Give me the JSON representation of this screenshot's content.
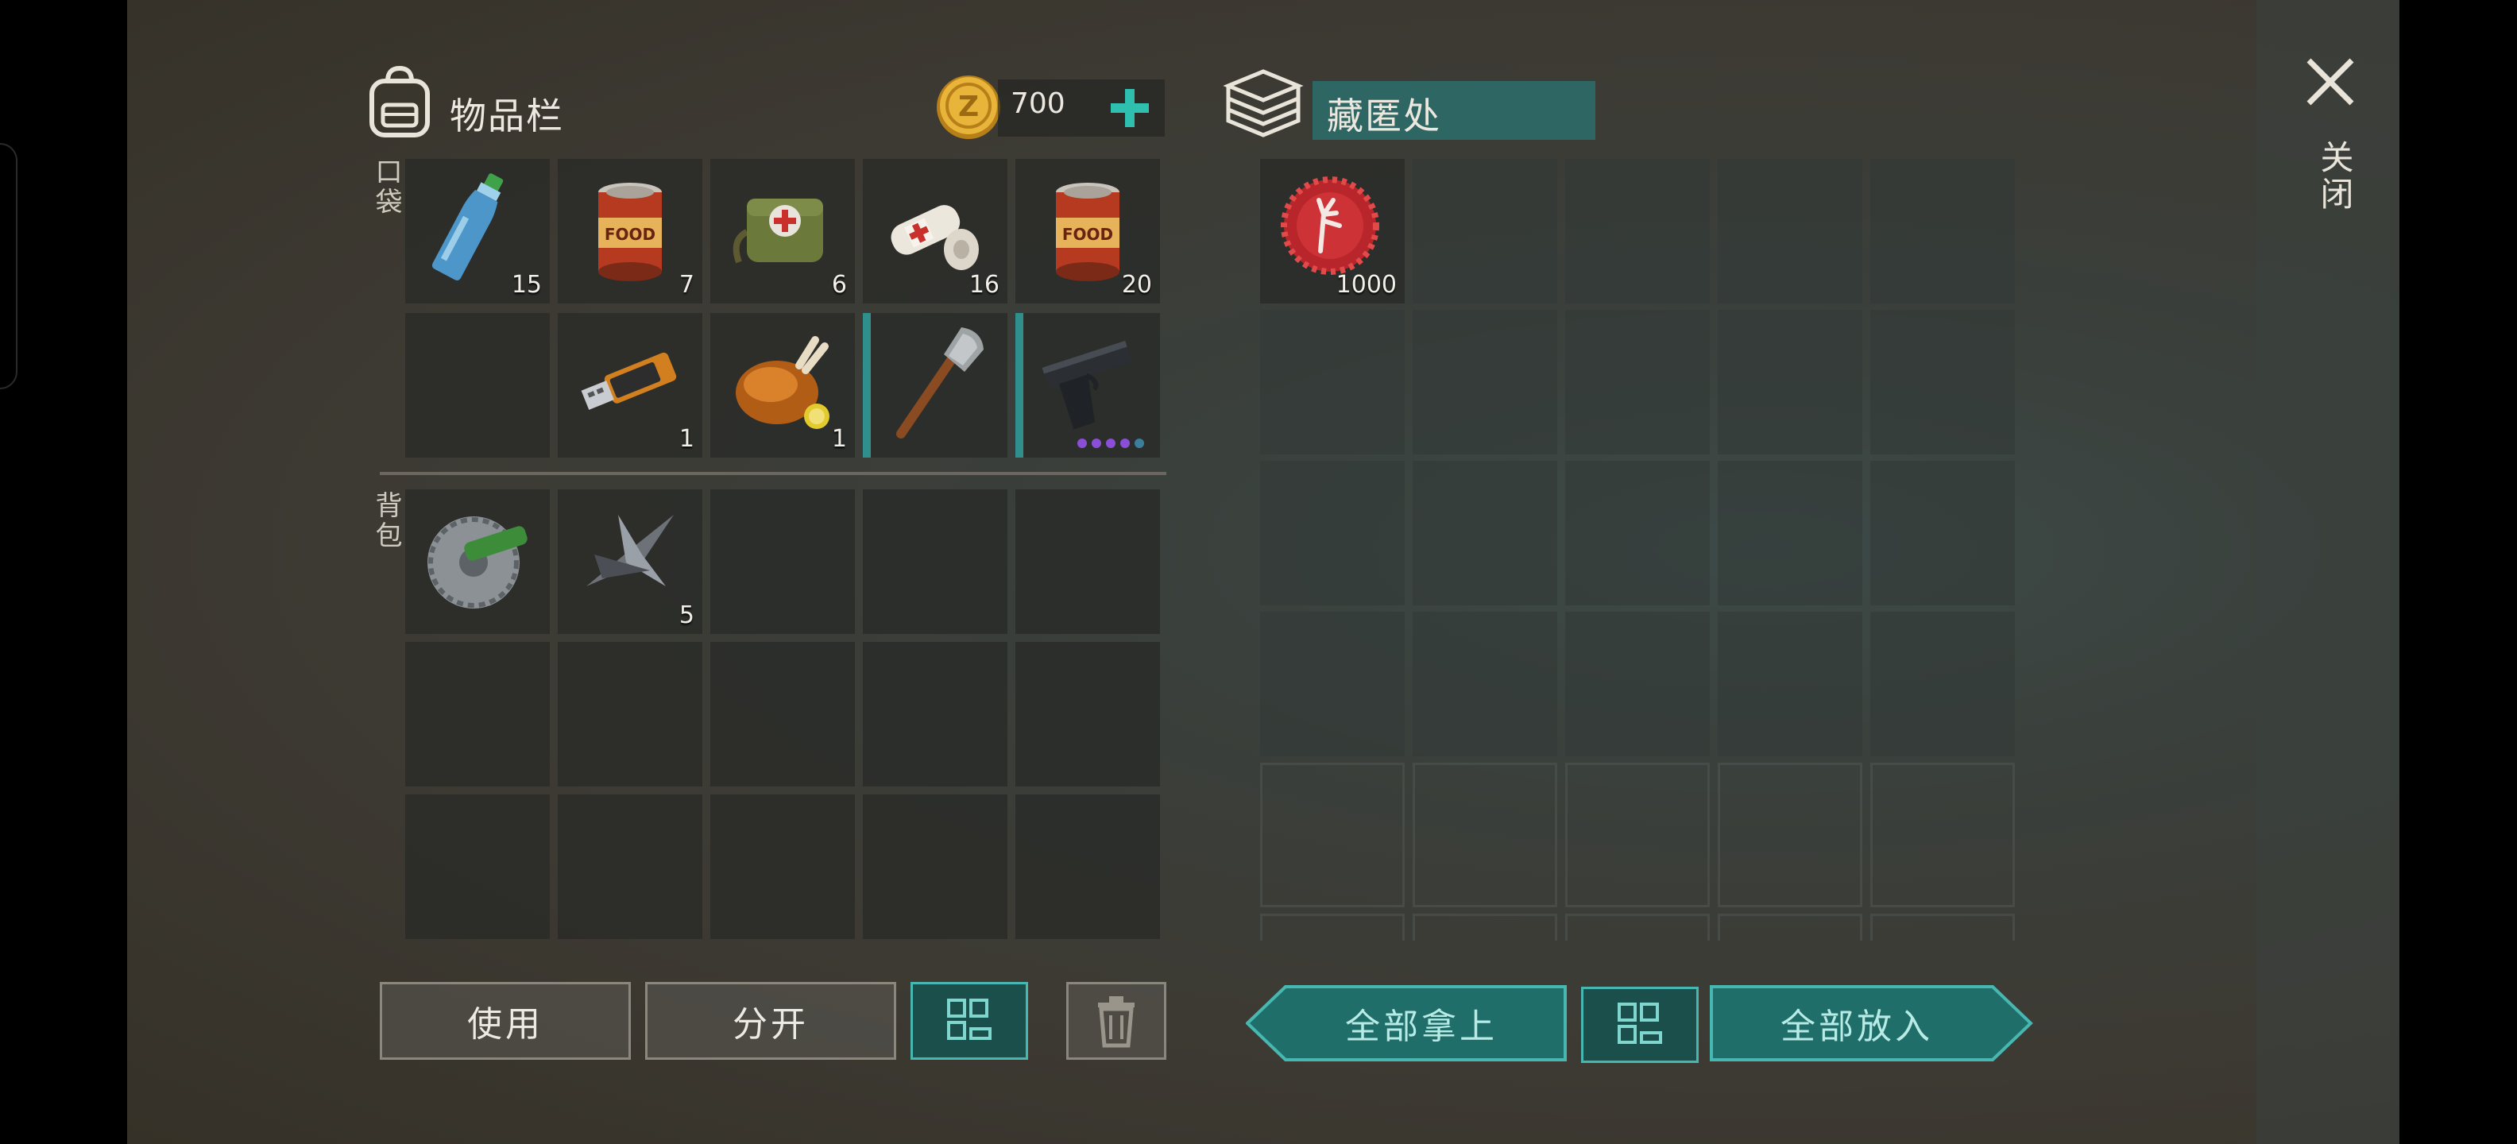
{
  "inventory": {
    "title": "物品栏",
    "currency_amount": "700",
    "section_pocket": "口袋",
    "section_backpack": "背包",
    "pocket_items": [
      {
        "name": "water-bottle",
        "count": "15"
      },
      {
        "name": "canned-food",
        "count": "7"
      },
      {
        "name": "medical-kit",
        "count": "6"
      },
      {
        "name": "bandage",
        "count": "16"
      },
      {
        "name": "canned-food",
        "count": "20"
      },
      {
        "name": "empty",
        "count": ""
      },
      {
        "name": "usb-drive",
        "count": "1"
      },
      {
        "name": "roast-chicken",
        "count": "1"
      },
      {
        "name": "shovel",
        "count": ""
      },
      {
        "name": "pistol",
        "count": ""
      }
    ],
    "backpack_items": [
      {
        "name": "circular-saw-blade",
        "count": ""
      },
      {
        "name": "metal-scrap",
        "count": "5"
      }
    ]
  },
  "stash": {
    "title": "藏匿处",
    "items": [
      {
        "name": "bottle-cap",
        "count": "1000"
      }
    ]
  },
  "close_label": "关闭",
  "buttons": {
    "use": "使用",
    "split": "分开",
    "take_all": "全部拿上",
    "put_all": "全部放入"
  },
  "colors": {
    "accent_teal": "#2f8f8c",
    "button_teal": "#1f6e6a",
    "coin_gold": "#d9a62a",
    "plus_green": "#2fbfae"
  }
}
